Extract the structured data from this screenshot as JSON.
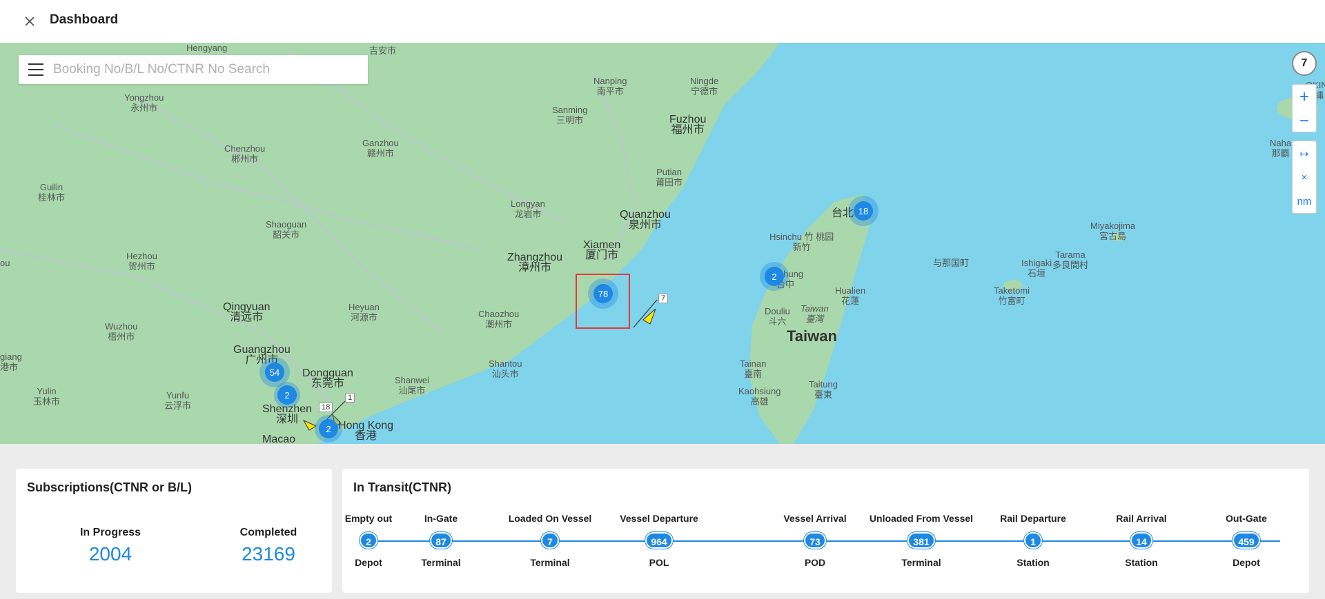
{
  "header": {
    "title": "Dashboard",
    "close_icon": "close-icon"
  },
  "search": {
    "placeholder": "Booking No/B/L No/CTNR No Search",
    "menu_icon": "menu-icon"
  },
  "map_controls": {
    "count": "7",
    "zoom_in": "+",
    "zoom_out": "−",
    "measure": "↦",
    "clear": "×",
    "unit": "nm"
  },
  "map_labels": [
    {
      "text": "吉安市",
      "cls": ""
    },
    {
      "text": "Nanping\n南平市",
      "cls": ""
    },
    {
      "text": "Ningde\n宁德市",
      "cls": ""
    },
    {
      "text": "Yongzhou\n永州市",
      "cls": ""
    },
    {
      "text": "Sanming\n三明市",
      "cls": ""
    },
    {
      "text": "Fuzhou\n福州市",
      "cls": "big"
    },
    {
      "text": "Chenzhou\n郴州市",
      "cls": ""
    },
    {
      "text": "Ganzhou\n赣州市",
      "cls": ""
    },
    {
      "text": "Putian\n莆田市",
      "cls": ""
    },
    {
      "text": "Guilin\n桂林市",
      "cls": ""
    },
    {
      "text": "Longyan\n龙岩市",
      "cls": ""
    },
    {
      "text": "Quanzhou\n泉州市",
      "cls": "big"
    },
    {
      "text": "台北",
      "cls": "big"
    },
    {
      "text": "Miyakojima\n宮古島",
      "cls": ""
    },
    {
      "text": "Naha\n那覇",
      "cls": ""
    },
    {
      "text": "Shaoguan\n韶关市",
      "cls": ""
    },
    {
      "text": "Hezhou\n贺州市",
      "cls": ""
    },
    {
      "text": "Zhangzhou\n漳州市",
      "cls": "big"
    },
    {
      "text": "Xiamen\n厦门市",
      "cls": "big"
    },
    {
      "text": "Hsinchu 竹 桃园\n新竹",
      "cls": ""
    },
    {
      "text": "与那国町",
      "cls": ""
    },
    {
      "text": "Ishigaki\n石垣",
      "cls": ""
    },
    {
      "text": "Tarama\n多良間村",
      "cls": ""
    },
    {
      "text": "Taketomi\n竹富町",
      "cls": ""
    },
    {
      "text": "Qingyuan\n清远市",
      "cls": "big"
    },
    {
      "text": "Heyuan\n河源市",
      "cls": ""
    },
    {
      "text": "Chaozhou\n潮州市",
      "cls": ""
    },
    {
      "text": "Taichung\n台中",
      "cls": ""
    },
    {
      "text": "Hualien\n花蓮",
      "cls": ""
    },
    {
      "text": "Douliu\n斗六",
      "cls": ""
    },
    {
      "text": "Taiwan\n臺灣",
      "cls": ""
    },
    {
      "text": "Taiwan",
      "cls": "country"
    },
    {
      "text": "Wuzhou\n梧州市",
      "cls": ""
    },
    {
      "text": "Guangzhou\n广州市",
      "cls": "big"
    },
    {
      "text": "Shantou\n汕头市",
      "cls": ""
    },
    {
      "text": "Tainan\n臺南",
      "cls": ""
    },
    {
      "text": "Dongguan\n东莞市",
      "cls": "big"
    },
    {
      "text": "Shanwei\n汕尾市",
      "cls": ""
    },
    {
      "text": "Kaohsiung\n高雄",
      "cls": ""
    },
    {
      "text": "Taitung\n臺東",
      "cls": ""
    },
    {
      "text": "Yulin\n玉林市",
      "cls": ""
    },
    {
      "text": "Yunfu\n云浮市",
      "cls": ""
    },
    {
      "text": "Shenzhen\n深圳",
      "cls": "big"
    },
    {
      "text": "Hong Kong\n香港",
      "cls": "big"
    },
    {
      "text": "Macao",
      "cls": "big"
    },
    {
      "text": "Hengyang",
      "cls": ""
    },
    {
      "text": "ou",
      "cls": ""
    },
    {
      "text": "giang\n港市",
      "cls": ""
    },
    {
      "text": "OKIN\n沖縄",
      "cls": ""
    }
  ],
  "clusters": [
    {
      "value": "78"
    },
    {
      "value": "18"
    },
    {
      "value": "2"
    },
    {
      "value": "54"
    },
    {
      "value": "2"
    },
    {
      "value": "2"
    }
  ],
  "ship_tags": [
    "7",
    "1",
    "18"
  ],
  "subscriptions": {
    "title": "Subscriptions(CTNR or B/L)",
    "in_progress_label": "In Progress",
    "in_progress_value": "2004",
    "completed_label": "Completed",
    "completed_value": "23169"
  },
  "transit": {
    "title": "In Transit(CTNR)",
    "stages": [
      {
        "top": "Empty out",
        "count": "2",
        "bottom": "Depot"
      },
      {
        "top": "In-Gate",
        "count": "87",
        "bottom": "Terminal"
      },
      {
        "top": "Loaded On Vessel",
        "count": "7",
        "bottom": "Terminal"
      },
      {
        "top": "Vessel Departure",
        "count": "964",
        "bottom": "POL"
      },
      {
        "top": "Vessel Arrival",
        "count": "73",
        "bottom": "POD"
      },
      {
        "top": "Unloaded From Vessel",
        "count": "381",
        "bottom": "Terminal"
      },
      {
        "top": "Rail Departure",
        "count": "1",
        "bottom": "Station"
      },
      {
        "top": "Rail Arrival",
        "count": "14",
        "bottom": "Station"
      },
      {
        "top": "Out-Gate",
        "count": "459",
        "bottom": "Depot"
      }
    ]
  },
  "colors": {
    "accent": "#1e88e5",
    "highlight": "#e53935",
    "sea": "#7fd3ea",
    "land": "#a9d8ad"
  }
}
